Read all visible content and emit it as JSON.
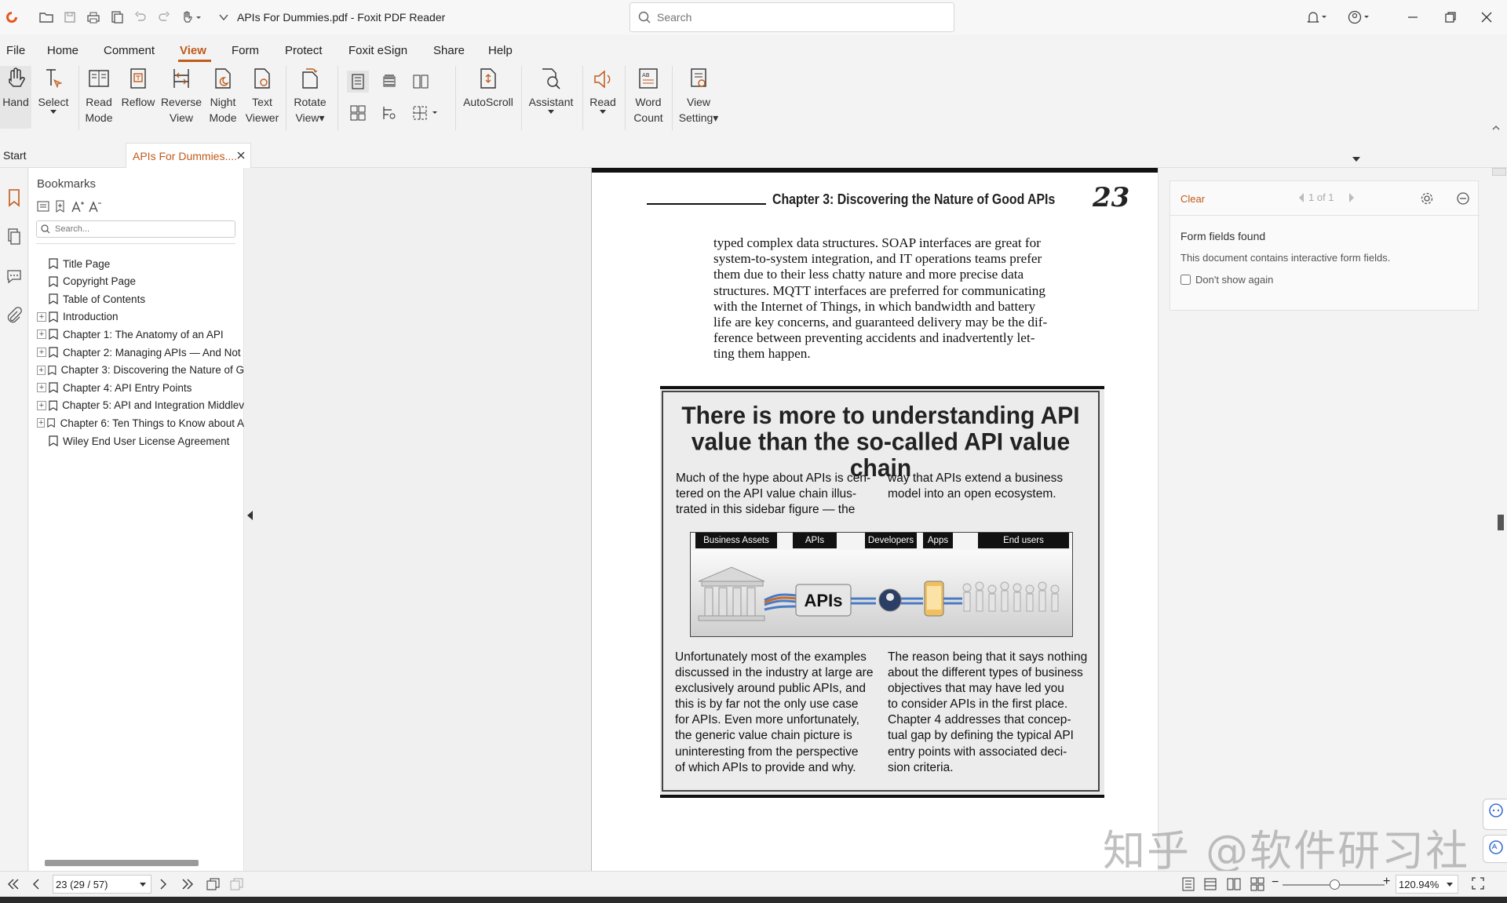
{
  "app": {
    "title": "APIs For Dummies.pdf - Foxit PDF Reader",
    "search_placeholder": "Search",
    "brand_color": "#c05a1a"
  },
  "menu": [
    "File",
    "Home",
    "Comment",
    "View",
    "Form",
    "Protect",
    "Foxit eSign",
    "Share",
    "Help"
  ],
  "menu_active": "View",
  "ribbon": {
    "hand": "Hand",
    "select": "Select",
    "read_mode": [
      "Read",
      "Mode"
    ],
    "reflow": "Reflow",
    "reverse_view": [
      "Reverse",
      "View"
    ],
    "night_mode": [
      "Night",
      "Mode"
    ],
    "text_viewer": [
      "Text",
      "Viewer"
    ],
    "rotate_view": [
      "Rotate",
      "View"
    ],
    "autoscroll": "AutoScroll",
    "assistant": "Assistant",
    "read": "Read",
    "word_count": [
      "Word",
      "Count"
    ],
    "view_setting": [
      "View",
      "Setting"
    ]
  },
  "tabs": {
    "start": "Start",
    "doc": "APIs For Dummies...."
  },
  "bookmarks": {
    "title": "Bookmarks",
    "search_placeholder": "Search...",
    "items": [
      {
        "label": "Title Page",
        "expandable": false
      },
      {
        "label": "Copyright Page",
        "expandable": false
      },
      {
        "label": "Table of Contents",
        "expandable": false
      },
      {
        "label": "Introduction",
        "expandable": true
      },
      {
        "label": "Chapter 1: The Anatomy of an API",
        "expandable": true
      },
      {
        "label": "Chapter 2: Managing APIs — And Not",
        "expandable": true
      },
      {
        "label": "Chapter 3: Discovering the Nature of G",
        "expandable": true
      },
      {
        "label": "Chapter 4: API Entry Points",
        "expandable": true
      },
      {
        "label": "Chapter 5: API and Integration Middlev",
        "expandable": true
      },
      {
        "label": "Chapter 6: Ten Things to Know about A",
        "expandable": true
      },
      {
        "label": "Wiley End User License Agreement",
        "expandable": false
      }
    ]
  },
  "page": {
    "chapter_heading": "Chapter 3: Discovering the Nature of Good APIs",
    "page_number": "23",
    "body_lines": [
      "typed complex data structures. SOAP interfaces are great for",
      "system-to-system integration, and IT operations teams prefer",
      "them due to their less chatty nature and more precise data",
      "structures. MQTT interfaces are preferred for communicating",
      "with the Internet of Things, in which bandwidth and battery",
      "life are key concerns, and guaranteed delivery may be the dif-",
      "ference between preventing accidents and inadvertently let-",
      "ting them happen."
    ],
    "sidebar": {
      "title_line1": "There is more to understanding API",
      "title_line2": "value than the so-called API value chain",
      "col1_top": [
        "Much of the hype about APIs is cen-",
        "tered on the API value chain illus-",
        "trated in this sidebar figure — the"
      ],
      "col2_top": [
        "way that APIs extend a business",
        "model into an open ecosystem."
      ],
      "figure_labels": [
        "Business Assets",
        "APIs",
        "Developers",
        "Apps",
        "End users"
      ],
      "figure_center_text": "APIs",
      "col1_bottom": [
        "Unfortunately most of the examples",
        "discussed in the industry at large are",
        "exclusively around public APIs, and",
        "this is by far not the only use case",
        "for APIs. Even more unfortunately,",
        "the generic value chain picture is",
        "uninteresting from the perspective",
        "of which APIs to provide and why."
      ],
      "col2_bottom": [
        "The reason being that it says nothing",
        "about the different types of business",
        "objectives that may have led you",
        "to consider APIs in the first place.",
        "Chapter 4 addresses that concep-",
        "tual gap by defining the typical API",
        "entry points with associated deci-",
        "sion criteria."
      ]
    }
  },
  "form_panel": {
    "clear": "Clear",
    "pager": "1 of 1",
    "title": "Form fields found",
    "message": "This document contains interactive form fields.",
    "dont_show": "Don't show again"
  },
  "status": {
    "page_value": "23 (29 / 57)",
    "zoom_value": "120.94%"
  },
  "watermark": "知乎 @软件研习社"
}
